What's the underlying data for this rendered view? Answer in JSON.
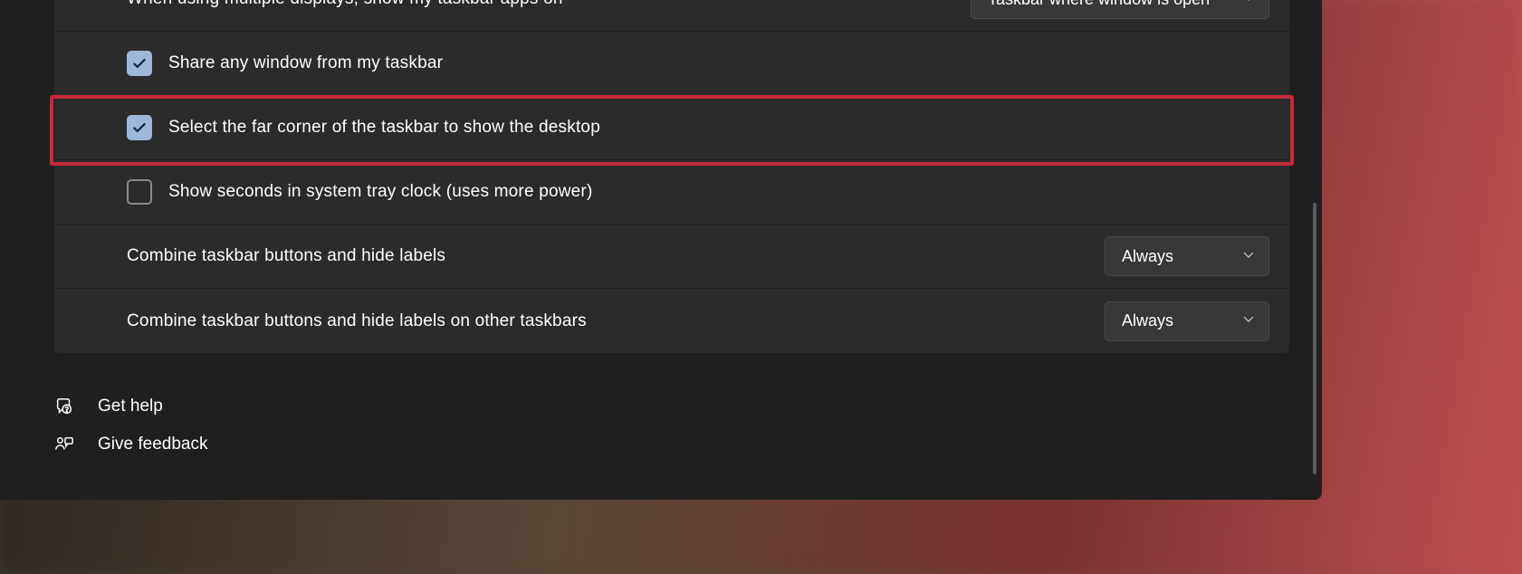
{
  "settings": {
    "row_multidisplay": {
      "label": "When using multiple displays, show my taskbar apps on",
      "value": "Taskbar where window is open"
    },
    "row_share": {
      "label": "Share any window from my taskbar",
      "checked": true
    },
    "row_corner": {
      "label": "Select the far corner of the taskbar to show the desktop",
      "checked": true
    },
    "row_seconds": {
      "label": "Show seconds in system tray clock (uses more power)",
      "checked": false
    },
    "row_combine": {
      "label": "Combine taskbar buttons and hide labels",
      "value": "Always"
    },
    "row_combine_other": {
      "label": "Combine taskbar buttons and hide labels on other taskbars",
      "value": "Always"
    }
  },
  "footer": {
    "help": "Get help",
    "feedback": "Give feedback"
  },
  "highlight": {
    "color": "#c42b3a"
  }
}
